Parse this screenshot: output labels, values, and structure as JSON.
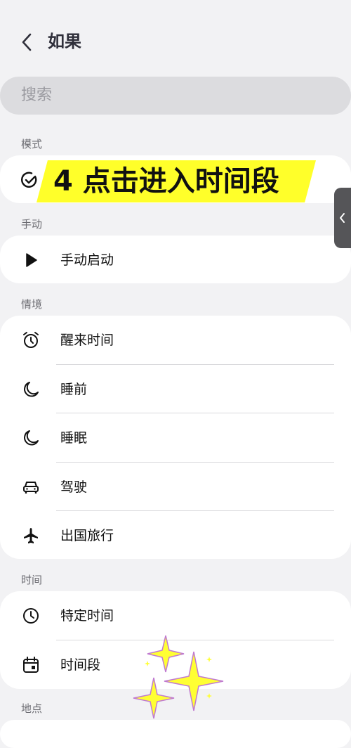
{
  "header": {
    "title": "如果",
    "back_icon": "chevron-left-icon"
  },
  "search": {
    "placeholder": "搜索"
  },
  "sections": {
    "mode": "模式",
    "manual": "手动",
    "context": "情境",
    "time": "时间",
    "location": "地点"
  },
  "overlay_text": "4 点击进入时间段",
  "manual_items": [
    {
      "label": "手动启动",
      "icon": "play-icon"
    }
  ],
  "context_items": [
    {
      "label": "醒来时间",
      "icon": "alarm-clock-icon"
    },
    {
      "label": "睡前",
      "icon": "moon-icon"
    },
    {
      "label": "睡眠",
      "icon": "moon-icon"
    },
    {
      "label": "驾驶",
      "icon": "car-icon"
    },
    {
      "label": "出国旅行",
      "icon": "airplane-icon"
    }
  ],
  "time_items": [
    {
      "label": "特定时间",
      "icon": "clock-icon"
    },
    {
      "label": "时间段",
      "icon": "calendar-icon"
    }
  ],
  "colors": {
    "highlight": "#ffff2a",
    "background": "#f2f2f4",
    "card": "#ffffff"
  }
}
